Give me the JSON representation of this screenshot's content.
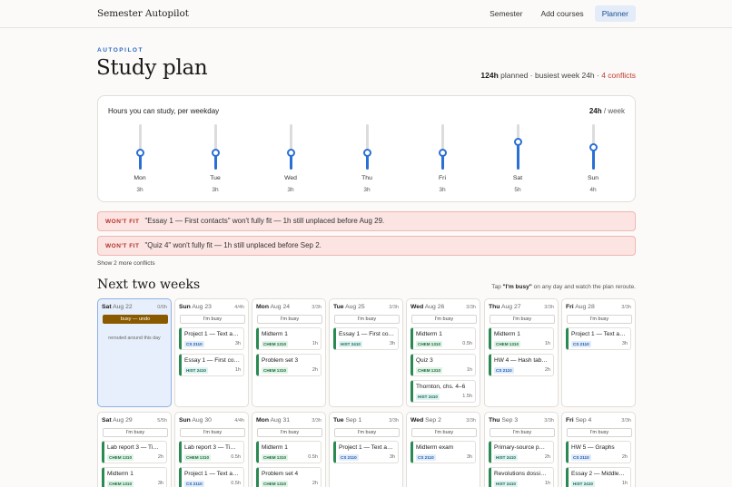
{
  "app": {
    "brand": "Semester Autopilot"
  },
  "nav": {
    "items": [
      {
        "label": "Semester"
      },
      {
        "label": "Add courses"
      },
      {
        "label": "Planner"
      }
    ]
  },
  "header": {
    "eyebrow": "AUTOPILOT",
    "title": "Study plan",
    "planned": "124h",
    "planned_suffix": " planned · busiest week 24h · ",
    "conflicts": "4 conflicts"
  },
  "hours": {
    "title": "Hours you can study, per weekday",
    "total": "24h",
    "total_suffix": " / week",
    "accent": "#2a6fd6",
    "days": [
      {
        "day": "Mon",
        "hours": "3h",
        "value": 3
      },
      {
        "day": "Tue",
        "hours": "3h",
        "value": 3
      },
      {
        "day": "Wed",
        "hours": "3h",
        "value": 3
      },
      {
        "day": "Thu",
        "hours": "3h",
        "value": 3
      },
      {
        "day": "Fri",
        "hours": "3h",
        "value": 3
      },
      {
        "day": "Sat",
        "hours": "5h",
        "value": 5
      },
      {
        "day": "Sun",
        "hours": "4h",
        "value": 4
      }
    ]
  },
  "conflicts": [
    {
      "badge": "WON'T FIT",
      "text": "\"Essay 1 — First contacts\" won't fully fit — 1h still unplaced before Aug 29."
    },
    {
      "badge": "WON'T FIT",
      "text": "\"Quiz 4\" won't fully fit — 1h still unplaced before Sep 2."
    }
  ],
  "more_conflicts": "Show 2 more conflicts",
  "weeks": {
    "title": "Next two weeks",
    "hint_pre": "Tap ",
    "hint_bold": "\"I'm busy\"",
    "hint_post": " on any day and watch the plan reroute.",
    "busy_label": "I'm busy",
    "busy_undo": "busy — undo",
    "rerouted": "rerouted around this day",
    "rows": [
      [
        {
          "dow": "Sat",
          "date": "Aug 22",
          "load": "0/0h",
          "busy": true,
          "tasks": []
        },
        {
          "dow": "Sun",
          "date": "Aug 23",
          "load": "4/4h",
          "tasks": [
            {
              "title": "Project 1 — Text a…",
              "tag": "CS 2110",
              "kind": "cs",
              "dur": "3h"
            },
            {
              "title": "Essay 1 — First co…",
              "tag": "HIST 2410",
              "kind": "hist",
              "dur": "1h"
            }
          ]
        },
        {
          "dow": "Mon",
          "date": "Aug 24",
          "load": "3/3h",
          "tasks": [
            {
              "title": "Midterm 1",
              "tag": "CHEM 1310",
              "kind": "chem",
              "dur": "1h"
            },
            {
              "title": "Problem set 3",
              "tag": "CHEM 1310",
              "kind": "chem",
              "dur": "2h"
            }
          ]
        },
        {
          "dow": "Tue",
          "date": "Aug 25",
          "load": "3/3h",
          "tasks": [
            {
              "title": "Essay 1 — First co…",
              "tag": "HIST 2410",
              "kind": "hist",
              "dur": "3h"
            }
          ]
        },
        {
          "dow": "Wed",
          "date": "Aug 26",
          "load": "3/3h",
          "tasks": [
            {
              "title": "Midterm 1",
              "tag": "CHEM 1310",
              "kind": "chem",
              "dur": "0.5h"
            },
            {
              "title": "Quiz 3",
              "tag": "CHEM 1310",
              "kind": "chem",
              "dur": "1h"
            },
            {
              "title": "Thornton, chs. 4–6",
              "tag": "HIST 2410",
              "kind": "hist",
              "dur": "1.5h"
            }
          ]
        },
        {
          "dow": "Thu",
          "date": "Aug 27",
          "load": "3/3h",
          "tasks": [
            {
              "title": "Midterm 1",
              "tag": "CHEM 1310",
              "kind": "chem",
              "dur": "1h"
            },
            {
              "title": "HW 4 — Hash tab…",
              "tag": "CS 2110",
              "kind": "cs",
              "dur": "2h"
            }
          ]
        },
        {
          "dow": "Fri",
          "date": "Aug 28",
          "load": "3/3h",
          "tasks": [
            {
              "title": "Project 1 — Text a…",
              "tag": "CS 2110",
              "kind": "cs",
              "dur": "3h"
            }
          ]
        }
      ],
      [
        {
          "dow": "Sat",
          "date": "Aug 29",
          "load": "5/5h",
          "tasks": [
            {
              "title": "Lab report 3 — Ti…",
              "tag": "CHEM 1310",
              "kind": "chem",
              "dur": "2h"
            },
            {
              "title": "Midterm 1",
              "tag": "CHEM 1310",
              "kind": "chem",
              "dur": "3h"
            }
          ]
        },
        {
          "dow": "Sun",
          "date": "Aug 30",
          "load": "4/4h",
          "tasks": [
            {
              "title": "Lab report 3 — Ti…",
              "tag": "CHEM 1310",
              "kind": "chem",
              "dur": "0.5h"
            },
            {
              "title": "Project 1 — Text a…",
              "tag": "CS 2110",
              "kind": "cs",
              "dur": "0.5h"
            }
          ]
        },
        {
          "dow": "Mon",
          "date": "Aug 31",
          "load": "3/3h",
          "tasks": [
            {
              "title": "Midterm 1",
              "tag": "CHEM 1310",
              "kind": "chem",
              "dur": "0.5h"
            },
            {
              "title": "Problem set 4",
              "tag": "CHEM 1310",
              "kind": "chem",
              "dur": "2h"
            }
          ]
        },
        {
          "dow": "Tue",
          "date": "Sep 1",
          "load": "3/3h",
          "tasks": [
            {
              "title": "Project 1 — Text a…",
              "tag": "CS 2110",
              "kind": "cs",
              "dur": "3h"
            }
          ]
        },
        {
          "dow": "Wed",
          "date": "Sep 2",
          "load": "3/3h",
          "tasks": [
            {
              "title": "Midterm exam",
              "tag": "CS 2110",
              "kind": "cs",
              "dur": "3h"
            }
          ]
        },
        {
          "dow": "Thu",
          "date": "Sep 3",
          "load": "3/3h",
          "tasks": [
            {
              "title": "Primary-source p…",
              "tag": "HIST 2410",
              "kind": "hist",
              "dur": "2h"
            },
            {
              "title": "Revolutions dossi…",
              "tag": "HIST 2410",
              "kind": "hist",
              "dur": "1h"
            }
          ]
        },
        {
          "dow": "Fri",
          "date": "Sep 4",
          "load": "3/3h",
          "tasks": [
            {
              "title": "HW 5 — Graphs",
              "tag": "CS 2110",
              "kind": "cs",
              "dur": "2h"
            },
            {
              "title": "Essay 2 — Middle…",
              "tag": "HIST 2410",
              "kind": "hist",
              "dur": "1h"
            }
          ]
        }
      ]
    ]
  }
}
